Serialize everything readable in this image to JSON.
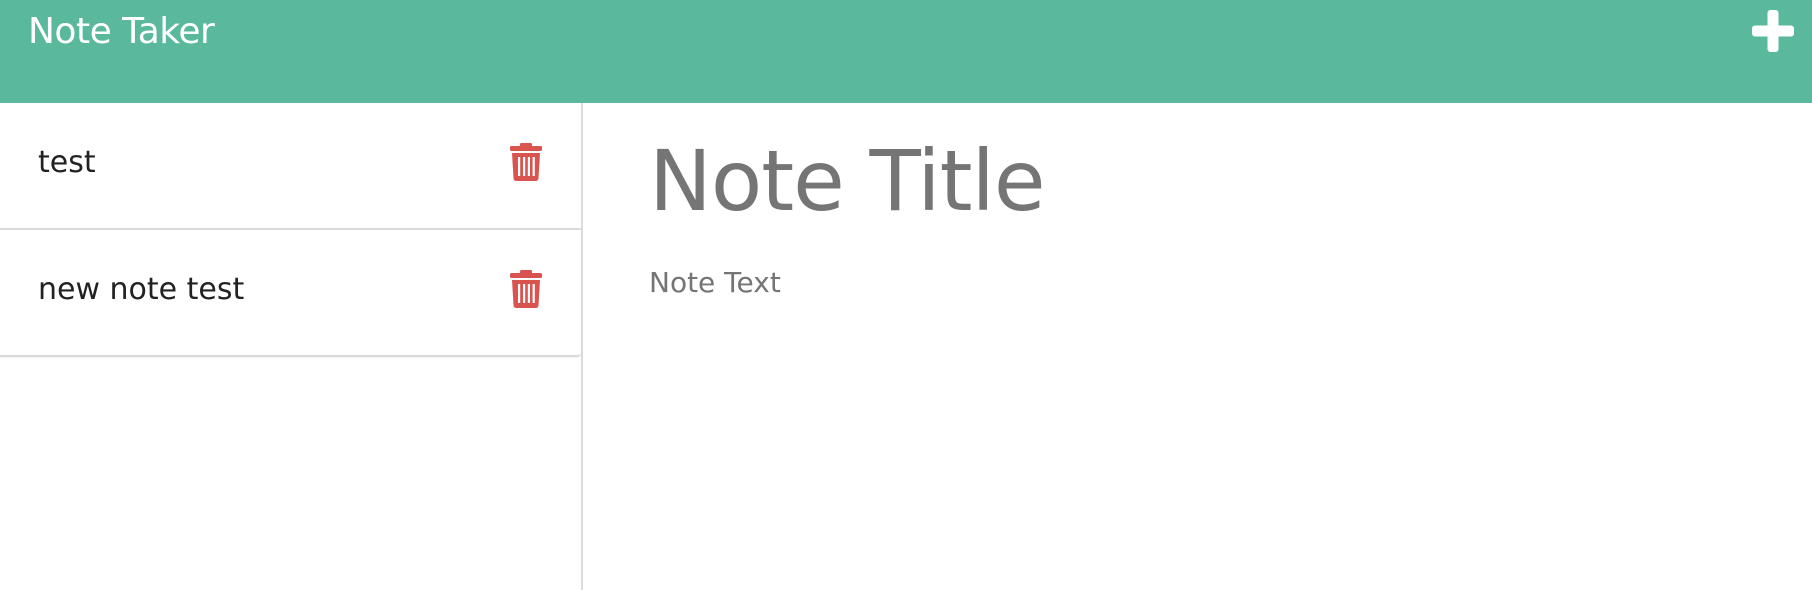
{
  "app": {
    "title": "Note Taker",
    "accent_color": "#5ab99c",
    "delete_color": "#d9534f"
  },
  "header": {
    "new_note_icon": "plus-icon"
  },
  "sidebar": {
    "notes": [
      {
        "title": "test",
        "delete_icon": "trash-icon"
      },
      {
        "title": "new note test",
        "delete_icon": "trash-icon"
      }
    ]
  },
  "editor": {
    "title_placeholder": "Note Title",
    "text_placeholder": "Note Text",
    "title_value": "",
    "text_value": ""
  }
}
